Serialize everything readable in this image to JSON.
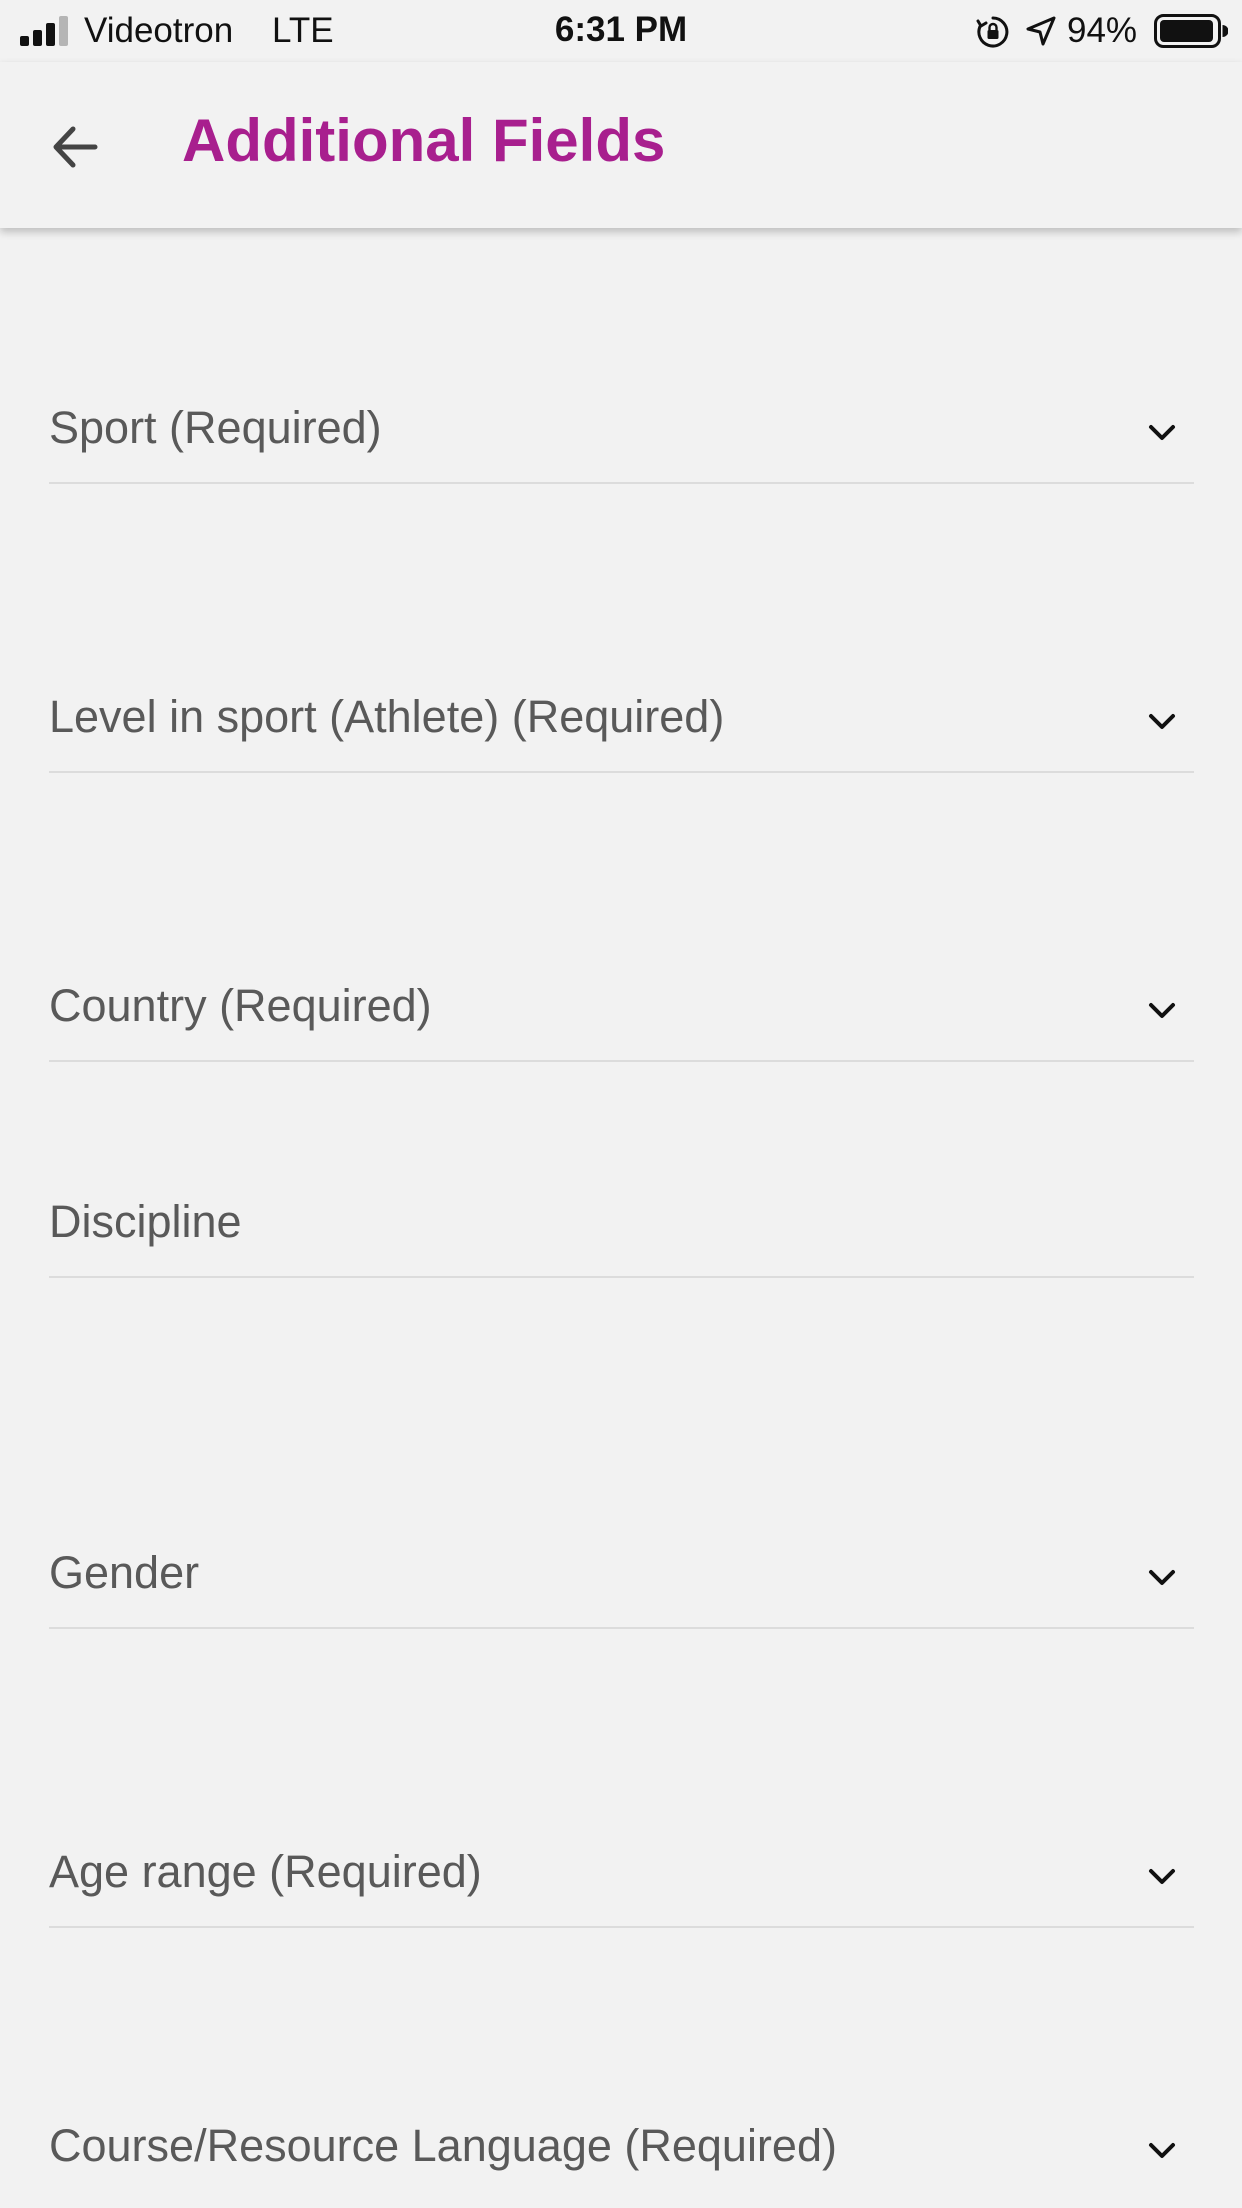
{
  "status_bar": {
    "carrier": "Videotron",
    "network": "LTE",
    "time": "6:31 PM",
    "battery": "94%"
  },
  "app_bar": {
    "title": "Additional Fields",
    "title_color": "#a81f8e",
    "back_icon": "arrow-left-icon"
  },
  "fields": [
    {
      "label": "Sport (Required)",
      "type": "dropdown"
    },
    {
      "label": "Level in sport (Athlete) (Required)",
      "type": "dropdown"
    },
    {
      "label": "Country (Required)",
      "type": "dropdown"
    },
    {
      "label": "Discipline",
      "type": "text"
    },
    {
      "label": "Gender",
      "type": "dropdown"
    },
    {
      "label": "Age range (Required)",
      "type": "dropdown"
    },
    {
      "label": "Course/Resource Language (Required)",
      "type": "dropdown"
    }
  ],
  "icons": {
    "dropdown": "chevron-down-icon"
  }
}
